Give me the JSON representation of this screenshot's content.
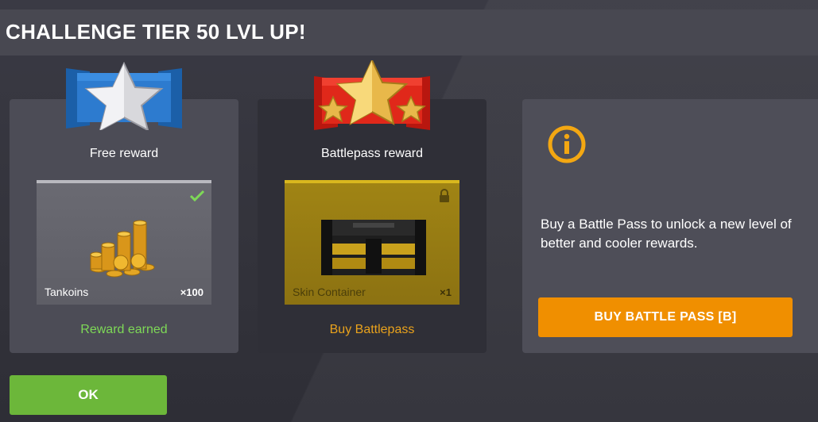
{
  "header": {
    "title": "CHALLENGE TIER 50 LVL UP!"
  },
  "free_reward": {
    "label": "Free reward",
    "item_name": "Tankoins",
    "quantity": "×100",
    "status": "Reward earned",
    "status_color": "#7ed957",
    "emblem_icon": "silver-star-emblem-icon",
    "item_icon": "coin-pile-icon"
  },
  "battlepass_reward": {
    "label": "Battlepass reward",
    "item_name": "Skin Container",
    "quantity": "×1",
    "status": "Buy Battlepass",
    "status_color": "#e9a21c",
    "emblem_icon": "gold-stars-emblem-icon",
    "item_icon": "container-chest-icon"
  },
  "info_panel": {
    "icon": "info-icon",
    "text": "Buy a Battle Pass to unlock a new level of better and cooler rewards.",
    "button_label": "BUY BATTLE PASS [B]",
    "button_color": "#f08f00"
  },
  "footer": {
    "ok_label": "OK",
    "ok_color": "#6cb73a"
  }
}
